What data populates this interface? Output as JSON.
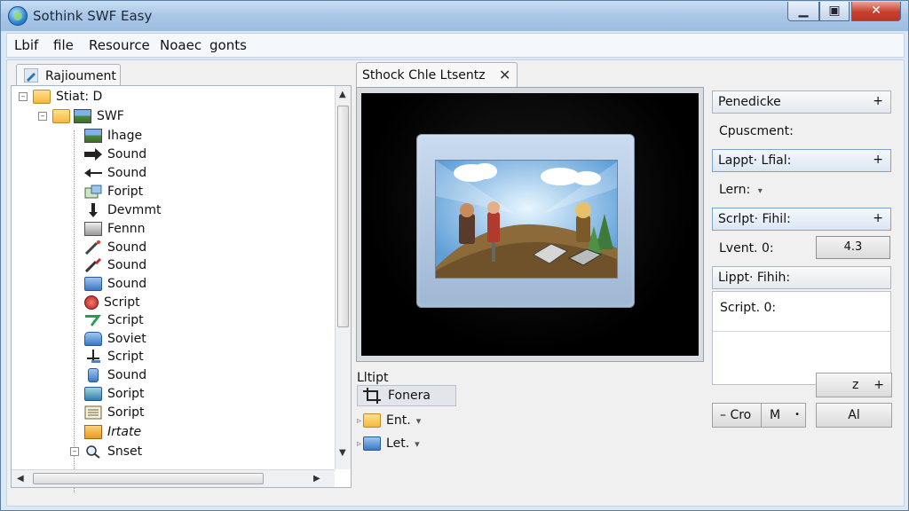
{
  "window": {
    "title": "Sothink SWF Easy",
    "controls": {
      "minimize": "▁",
      "maximize": "▣",
      "close": "✕"
    }
  },
  "menu": {
    "items": [
      "Lbif",
      "file",
      "Resource",
      "Noaec",
      "gonts"
    ]
  },
  "left_panel": {
    "tab_label": "Rajioument",
    "tree": [
      {
        "label": "Stiat: D",
        "expander": "–",
        "icon": "folder-icon"
      },
      {
        "label": "SWF",
        "expander": "–",
        "icon": "image-icon"
      },
      {
        "label": "Ihage",
        "icon": "image-icon"
      },
      {
        "label": "Sound",
        "icon": "arrow-right-icon"
      },
      {
        "label": "Sound",
        "icon": "arrow-left-icon"
      },
      {
        "label": "Foript",
        "icon": "script-icon"
      },
      {
        "label": "Devmmt",
        "icon": "pin-icon"
      },
      {
        "label": "Fennn",
        "icon": "panel-icon"
      },
      {
        "label": "Sound",
        "icon": "wand-icon"
      },
      {
        "label": "Sound",
        "icon": "brush-icon"
      },
      {
        "label": "Sound",
        "icon": "blue-box-icon"
      },
      {
        "label": "Script",
        "icon": "ruby-icon"
      },
      {
        "label": "Script",
        "icon": "green-check-icon"
      },
      {
        "label": "Soviet",
        "icon": "document-icon"
      },
      {
        "label": "Script",
        "icon": "move-icon"
      },
      {
        "label": "Sound",
        "icon": "cylinder-icon"
      },
      {
        "label": "Soript",
        "icon": "blue-cube-icon"
      },
      {
        "label": "Soript",
        "icon": "list-icon"
      },
      {
        "label": "Irtate",
        "icon": "orange-box-icon"
      },
      {
        "label": "Snset",
        "expander": "–",
        "icon": "magnifier-icon"
      }
    ]
  },
  "preview": {
    "tab_label": "Sthock Chle Ltsentz",
    "close": "✕"
  },
  "below_preview": {
    "label": "Lltipt",
    "items": [
      {
        "label": "Fonera",
        "icon": "crop-icon",
        "selected": true
      },
      {
        "label": "Ent.",
        "icon": "folder-image-icon",
        "dropdown": "▾"
      },
      {
        "label": "Let.",
        "icon": "layers-icon",
        "dropdown": "▾"
      }
    ]
  },
  "right_panel": {
    "row1": "Penedicke",
    "text1": "Cpuscment:",
    "row2": "Lappt· Lfial:",
    "text2": "Lern:",
    "row3": "Scrlpt· Fihil:",
    "text3": "Lvent. 0:",
    "field_value": "4.3",
    "row4": "Lippt· Fihih:",
    "text4": "Script. 0:",
    "btn_z": "z",
    "btn_seg_left": "– Cro",
    "btn_seg_mid": "M",
    "btn_right": "Al"
  },
  "colors": {
    "accent": "#7fa3cc",
    "close_red": "#c8402b"
  }
}
